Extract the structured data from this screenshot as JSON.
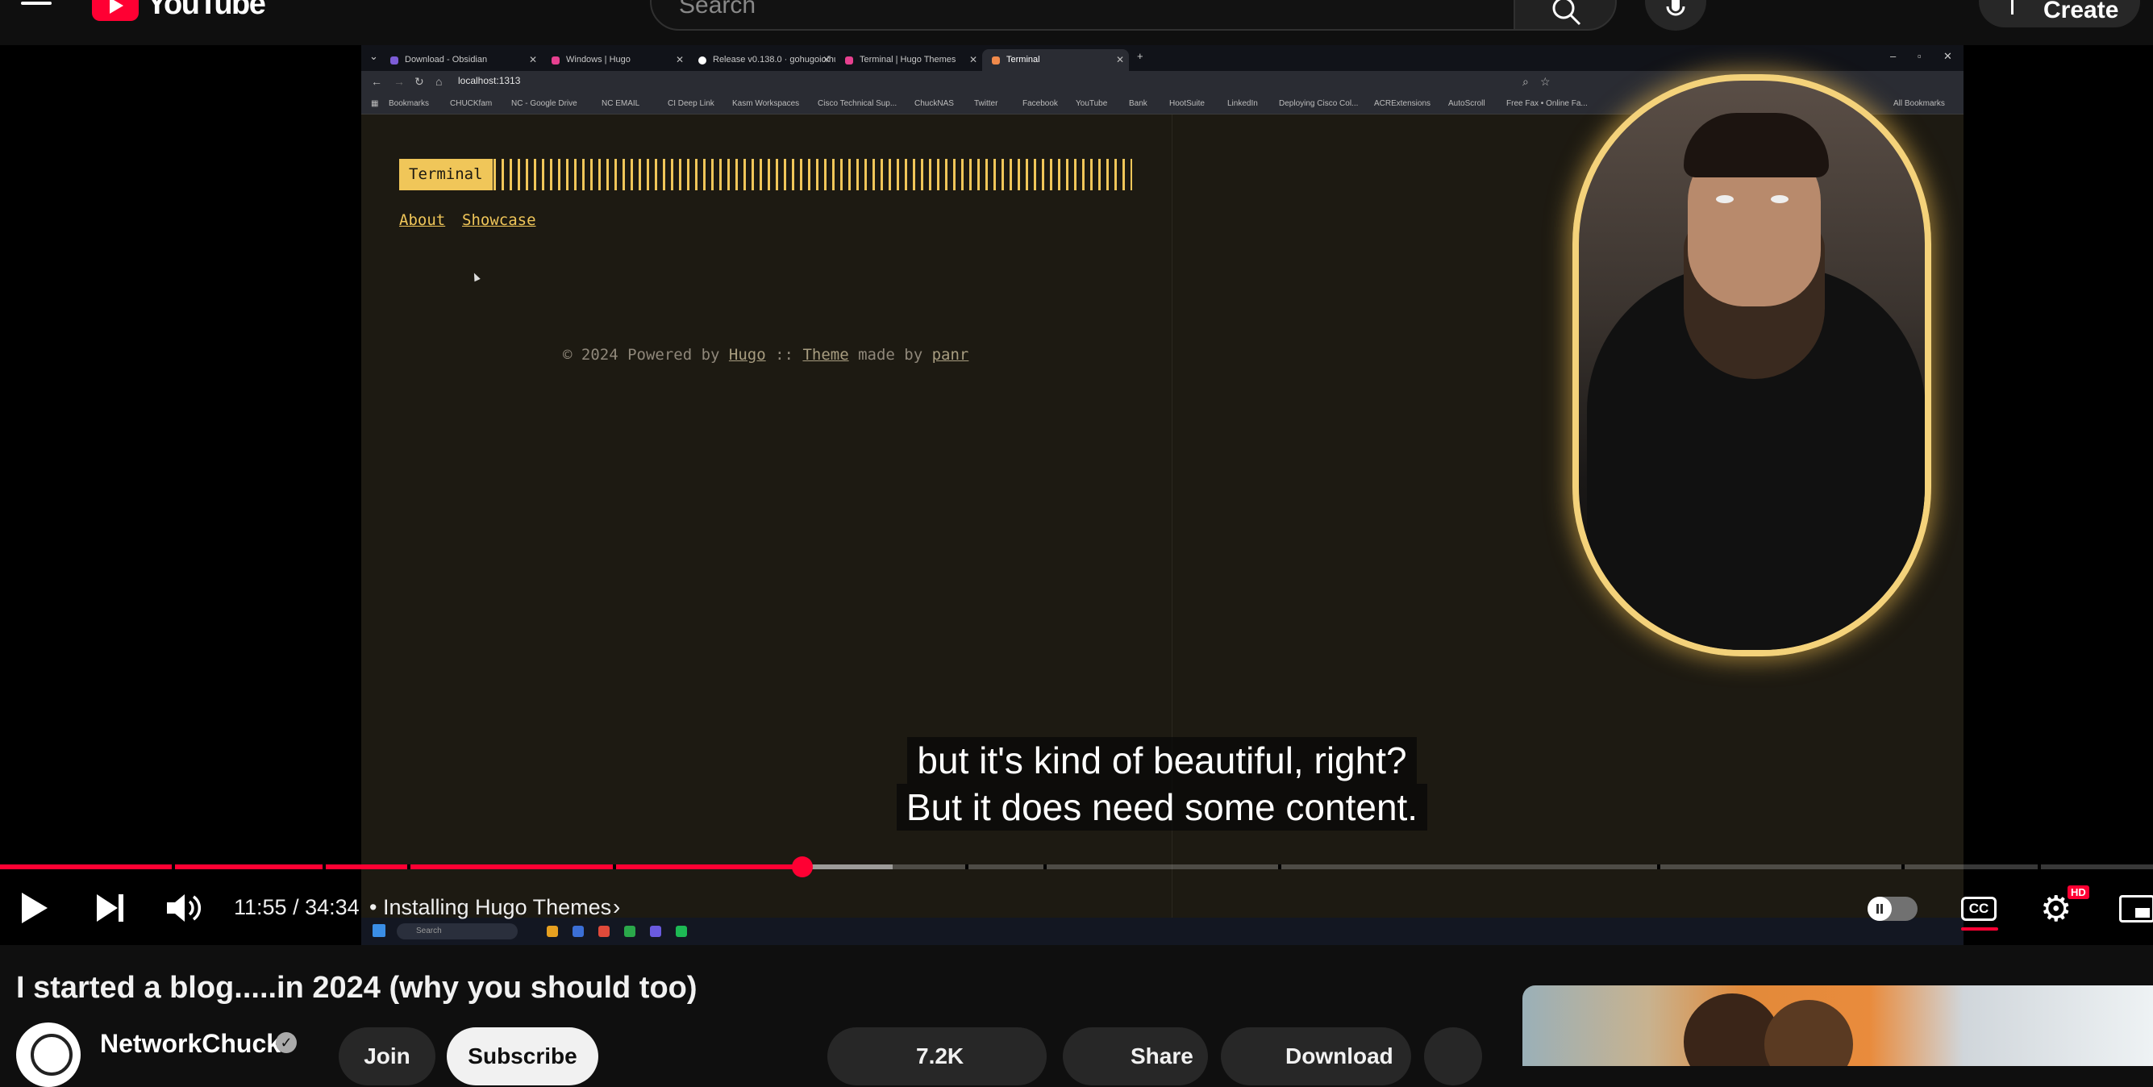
{
  "masthead": {
    "logo_text": "YouTube",
    "search_placeholder": "Search",
    "create_label": "Create"
  },
  "browser": {
    "tabs": [
      {
        "label": "Download - Obsidian",
        "color": "#7c5cd6"
      },
      {
        "label": "Windows | Hugo",
        "color": "#e6408f"
      },
      {
        "label": "Release v0.138.0 · gohugoio/hu",
        "color": "#ffffff"
      },
      {
        "label": "Terminal | Hugo Themes",
        "color": "#e6408f"
      },
      {
        "label": "Terminal",
        "color": "#f08a4b"
      }
    ],
    "url": "localhost:1313",
    "bookmarks": [
      "Bookmarks",
      "CHUCKfam",
      "NC - Google Drive",
      "NC EMAIL",
      "CI Deep Link",
      "Kasm Workspaces",
      "Cisco Technical Sup...",
      "ChuckNAS",
      "Twitter",
      "Facebook",
      "YouTube",
      "Bank",
      "HootSuite",
      "LinkedIn",
      "Deploying Cisco Col...",
      "ACRExtensions",
      "AutoScroll",
      "Free Fax • Online Fa...",
      "All Bookmarks"
    ]
  },
  "hugo_site": {
    "logo": "Terminal",
    "nav": [
      "About",
      "Showcase"
    ],
    "footer": {
      "prefix": "© 2024 Powered by ",
      "hugo": "Hugo",
      "sep": " :: ",
      "theme": "Theme",
      "made_by": " made by ",
      "author": "panr"
    },
    "accent": "#f0c659",
    "background": "#1d1a12"
  },
  "taskbar": {
    "search": "Search"
  },
  "captions": {
    "line1": "but it's kind of beautiful, right?",
    "line2": "But it does need some content."
  },
  "player": {
    "current_time": "11:55",
    "duration": "34:34",
    "time_display": "11:55 / 34:34",
    "chapter_separator": "•",
    "chapter": "Installing Hugo Themes",
    "played_fraction": 0.3725,
    "buffered_fraction": 0.4145,
    "cc_label": "CC",
    "hd_badge": "HD",
    "progress_color": "#ff0033"
  },
  "video": {
    "title": "I started a blog.....in 2024 (why you should too)",
    "channel": "NetworkChuck",
    "verified_glyph": "✓",
    "join_label": "Join",
    "subscribe_label": "Subscribe",
    "like_count": "7.2K",
    "share_label": "Share",
    "download_label": "Download"
  }
}
